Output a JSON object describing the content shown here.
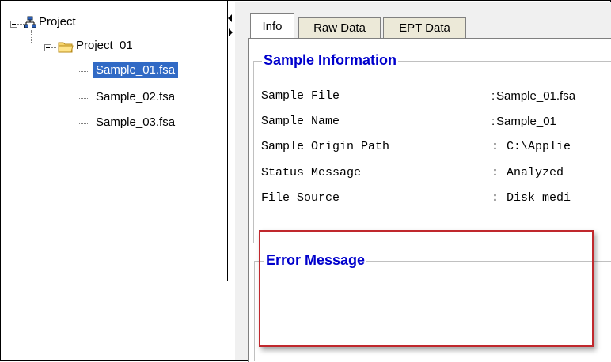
{
  "tree": {
    "root": {
      "label": "Project",
      "icon": "hierarchy-icon"
    },
    "folder": {
      "label": "Project_01",
      "icon": "folder-icon"
    },
    "files": [
      {
        "label": "Sample_01.fsa",
        "selected": true
      },
      {
        "label": "Sample_02.fsa",
        "selected": false
      },
      {
        "label": "Sample_03.fsa",
        "selected": false
      }
    ]
  },
  "tabs": [
    {
      "label": "Info",
      "active": true
    },
    {
      "label": "Raw Data",
      "active": false
    },
    {
      "label": "EPT Data",
      "active": false
    }
  ],
  "sample_info": {
    "title": "Sample Information",
    "rows": [
      {
        "label": "Sample File",
        "sep": ":",
        "value": "Sample_01.fsa"
      },
      {
        "label": "Sample Name",
        "sep": ":",
        "value": "Sample_01"
      },
      {
        "label": "Sample Origin Path",
        "sep": ":",
        "value": "C:\\Applie"
      },
      {
        "label": "Status Message",
        "sep": ":",
        "value": "Analyzed"
      },
      {
        "label": "File Source",
        "sep": ":",
        "value": "Disk medi"
      }
    ]
  },
  "error_message": {
    "title": "Error Message",
    "highlight_color": "#c0282d"
  },
  "colors": {
    "selection": "#316ac5",
    "group_title": "#0000cc"
  }
}
